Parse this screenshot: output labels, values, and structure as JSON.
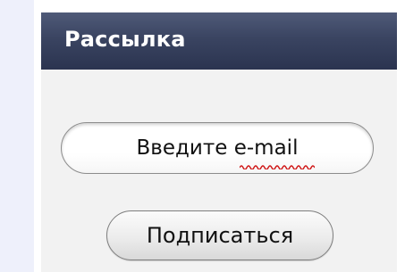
{
  "newsletter": {
    "title": "Рассылка",
    "email_placeholder": "Введите e-mail",
    "subscribe_label": "Подписаться"
  },
  "colors": {
    "header_bg": "#2f3855",
    "header_text": "#ffffff",
    "panel_bg": "#f2f2f2",
    "left_strip_bg": "#eef0fb",
    "spellcheck_underline": "#d01818"
  }
}
